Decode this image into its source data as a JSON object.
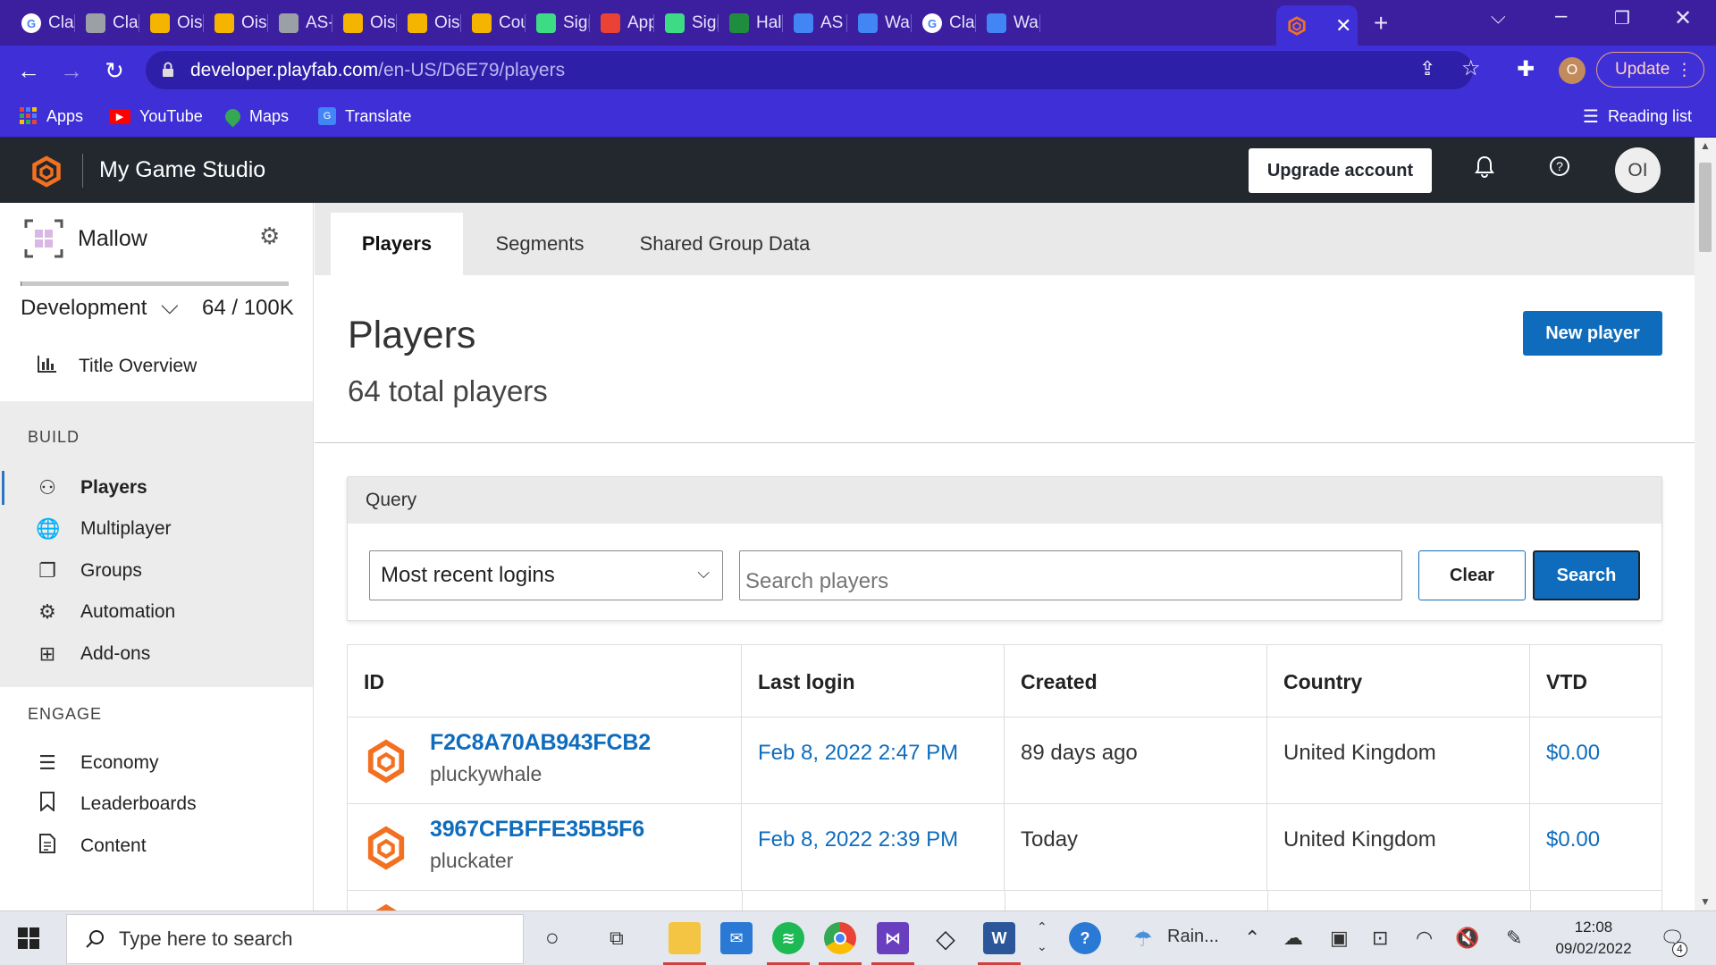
{
  "browser": {
    "tabs": [
      {
        "label": "Cla",
        "icon": "google-icon",
        "color": "#ffffff"
      },
      {
        "label": "Cla",
        "icon": "classroom-icon",
        "color": "#9aa0a6"
      },
      {
        "label": "Oisi",
        "icon": "slides-icon",
        "color": "#f4b400"
      },
      {
        "label": "Oisi",
        "icon": "slides-icon",
        "color": "#f4b400"
      },
      {
        "label": "AS-",
        "icon": "classroom-icon",
        "color": "#9aa0a6"
      },
      {
        "label": "Oisi",
        "icon": "slides-icon",
        "color": "#f4b400"
      },
      {
        "label": "Oisi",
        "icon": "slides-icon",
        "color": "#f4b400"
      },
      {
        "label": "Cou",
        "icon": "classroom-icon",
        "color": "#f4b400"
      },
      {
        "label": "Sign",
        "icon": "unity-icon",
        "color": "#3ddc84"
      },
      {
        "label": "App",
        "icon": "app-icon",
        "color": "#ea4335"
      },
      {
        "label": "Sign",
        "icon": "unity-icon",
        "color": "#3ddc84"
      },
      {
        "label": "Hal",
        "icon": "classroom-icon",
        "color": "#1e8e3e"
      },
      {
        "label": "AS (",
        "icon": "docs-icon",
        "color": "#4285f4"
      },
      {
        "label": "Wa",
        "icon": "classroom-icon",
        "color": "#4285f4"
      },
      {
        "label": "Cla",
        "icon": "google-icon",
        "color": "#ffffff"
      },
      {
        "label": "Wa",
        "icon": "classroom-icon",
        "color": "#4285f4"
      }
    ],
    "active_tab_icon": "playfab-icon",
    "url_host": "developer.playfab.com",
    "url_path": "/en-US/D6E79/players",
    "profile_initial": "O",
    "update_label": "Update",
    "bookmarks": [
      {
        "label": "Apps",
        "icon": "apps-grid-icon"
      },
      {
        "label": "YouTube",
        "icon": "youtube-icon"
      },
      {
        "label": "Maps",
        "icon": "maps-icon"
      },
      {
        "label": "Translate",
        "icon": "translate-icon"
      }
    ],
    "reading_list": "Reading list"
  },
  "header": {
    "studio": "My Game Studio",
    "upgrade": "Upgrade account",
    "avatar": "OI"
  },
  "sidebar": {
    "title": "Mallow",
    "environment": "Development",
    "quota": "64 / 100K",
    "quota_fraction": 0.00064,
    "overview": "Title Overview",
    "build_heading": "BUILD",
    "build_items": [
      {
        "label": "Players",
        "icon": "players-icon",
        "selected": true
      },
      {
        "label": "Multiplayer",
        "icon": "globe-icon",
        "selected": false
      },
      {
        "label": "Groups",
        "icon": "groups-icon",
        "selected": false
      },
      {
        "label": "Automation",
        "icon": "automation-icon",
        "selected": false
      },
      {
        "label": "Add-ons",
        "icon": "addons-icon",
        "selected": false
      }
    ],
    "engage_heading": "ENGAGE",
    "engage_items": [
      {
        "label": "Economy",
        "icon": "economy-icon"
      },
      {
        "label": "Leaderboards",
        "icon": "bookmark-icon"
      },
      {
        "label": "Content",
        "icon": "document-icon"
      }
    ]
  },
  "main": {
    "tabs": [
      "Players",
      "Segments",
      "Shared Group Data"
    ],
    "title": "Players",
    "total": "64 total players",
    "new_player": "New player",
    "query": {
      "heading": "Query",
      "selected": "Most recent logins",
      "placeholder": "Search players",
      "clear": "Clear",
      "search": "Search"
    },
    "table": {
      "columns": [
        "ID",
        "Last login",
        "Created",
        "Country",
        "VTD"
      ],
      "rows": [
        {
          "id": "F2C8A70AB943FCB2",
          "name": "pluckywhale",
          "last_login": "Feb 8, 2022 2:47 PM",
          "created": "89 days ago",
          "country": "United Kingdom",
          "vtd": "$0.00"
        },
        {
          "id": "3967CFBFFE35B5F6",
          "name": "pluckater",
          "last_login": "Feb 8, 2022 2:39 PM",
          "created": "Today",
          "country": "United Kingdom",
          "vtd": "$0.00"
        }
      ]
    }
  },
  "taskbar": {
    "search_placeholder": "Type here to search",
    "weather": "Rain...",
    "time": "12:08",
    "date": "09/02/2022",
    "notifications": "4"
  },
  "colors": {
    "chrome_purple": "#3f2fd6",
    "playfab_orange": "#f37021",
    "accent_blue": "#0f6cbd"
  }
}
